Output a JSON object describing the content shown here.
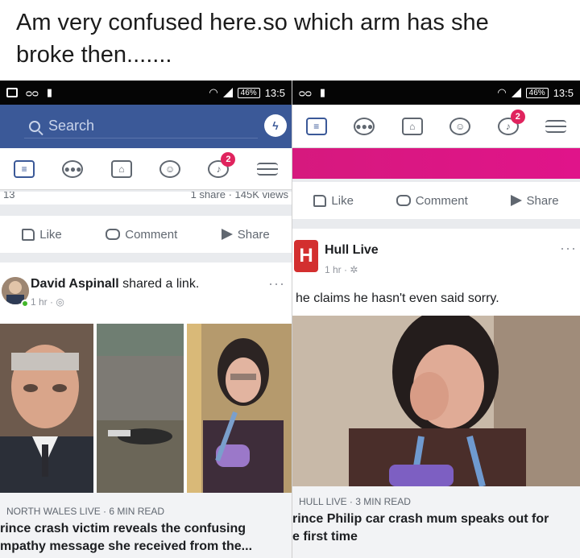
{
  "caption": {
    "line1": "Am very confused here.so which arm has she",
    "line2": "broke then......."
  },
  "left": {
    "status": {
      "time": "13:5",
      "battery": "46%"
    },
    "search_placeholder": "Search",
    "notification_count": "2",
    "stats": {
      "left": "13",
      "right": "1 share · 145K views"
    },
    "actions": {
      "like": "Like",
      "comment": "Comment",
      "share": "Share"
    },
    "post": {
      "author": "David Aspinall",
      "action_text": "shared a link.",
      "time": "1 hr ·",
      "more": "···",
      "link": {
        "source": "NORTH WALES LIVE · 6 MIN READ",
        "title_line1": "rince crash victim reveals the confusing",
        "title_line2": "mpathy message she received from the..."
      }
    }
  },
  "right": {
    "status": {
      "time": "13:5",
      "battery": "46%"
    },
    "notification_count": "2",
    "actions": {
      "like": "Like",
      "comment": "Comment",
      "share": "Share"
    },
    "post": {
      "author": "Hull Live",
      "avatar_letter": "H",
      "time": "1 hr ·",
      "more": "···",
      "text": "he claims he hasn't even said sorry.",
      "link": {
        "source": "HULL LIVE · 3 MIN READ",
        "title_line1": "rince Philip car crash mum speaks out for",
        "title_line2": "e first time"
      }
    }
  },
  "colors": {
    "facebook_blue": "#3b5998",
    "badge": "#e0245e",
    "online": "#42b72a",
    "magenta_bar": "#d6197e"
  }
}
